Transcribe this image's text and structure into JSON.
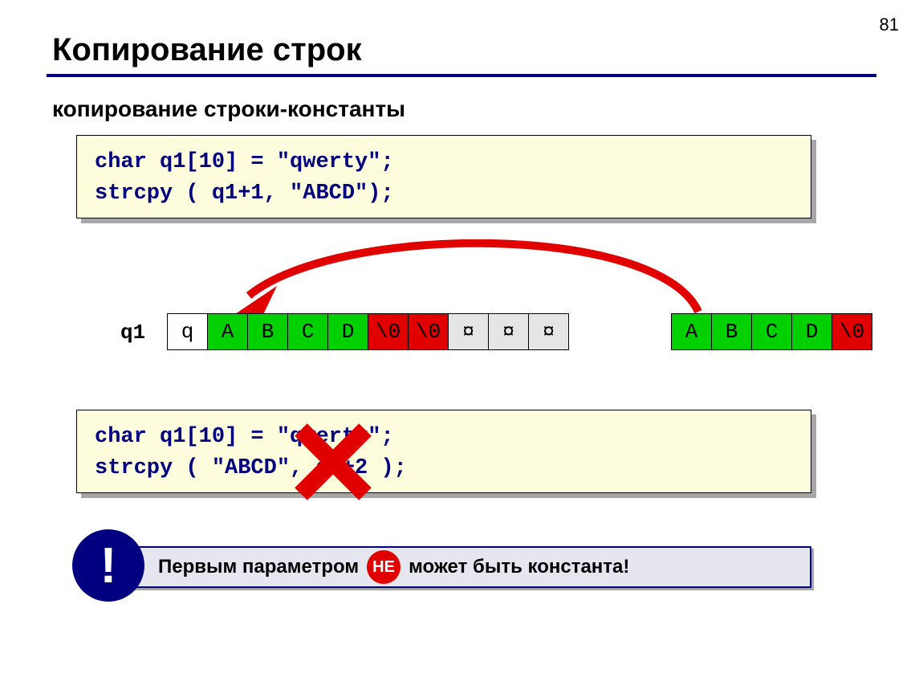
{
  "page_number": "81",
  "title": "Копирование строк",
  "subtitle": "копирование строки-константы",
  "code1": {
    "line1": "char q1[10] = \"qwerty\";",
    "line2": "strcpy ( q1+1, \"ABCD\");"
  },
  "q1_label": "q1",
  "array_main": [
    {
      "v": "q",
      "cls": "white"
    },
    {
      "v": "A",
      "cls": "green"
    },
    {
      "v": "B",
      "cls": "green"
    },
    {
      "v": "C",
      "cls": "green"
    },
    {
      "v": "D",
      "cls": "green"
    },
    {
      "v": "\\0",
      "cls": "red"
    },
    {
      "v": "\\0",
      "cls": "red"
    },
    {
      "v": "¤",
      "cls": "grey"
    },
    {
      "v": "¤",
      "cls": "grey"
    },
    {
      "v": "¤",
      "cls": "grey"
    }
  ],
  "array_src": [
    {
      "v": "A",
      "cls": "green"
    },
    {
      "v": "B",
      "cls": "green"
    },
    {
      "v": "C",
      "cls": "green"
    },
    {
      "v": "D",
      "cls": "green"
    },
    {
      "v": "\\0",
      "cls": "red"
    }
  ],
  "code2": {
    "line1": "char q1[10] = \"qwerty\";",
    "line2": "strcpy ( \"ABCD\", q1+2 );"
  },
  "warning": {
    "bang": "!",
    "text_before": "Первым параметром",
    "badge": "НЕ",
    "text_after": "может быть константа!"
  }
}
